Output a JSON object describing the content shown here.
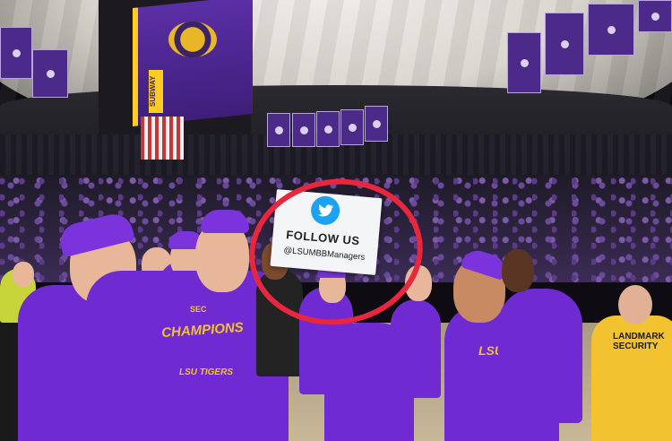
{
  "photo": {
    "sign": {
      "icon": "twitter-bird-icon",
      "title": "FOLLOW US",
      "handle": "@LSUMBBManagers"
    },
    "shirt_graphic": {
      "badge": "SEC",
      "title": "CHAMPIONS",
      "subtitle": "LSU TIGERS"
    },
    "polo_logo": "LSU",
    "security_shirt": [
      "LANDMARK",
      "SECURITY"
    ],
    "scoreboard_sponsor": "SUBWAY",
    "annotation_color": "#e8263d",
    "team_color": "#6f2bd1",
    "accent_color": "#f2c230"
  }
}
